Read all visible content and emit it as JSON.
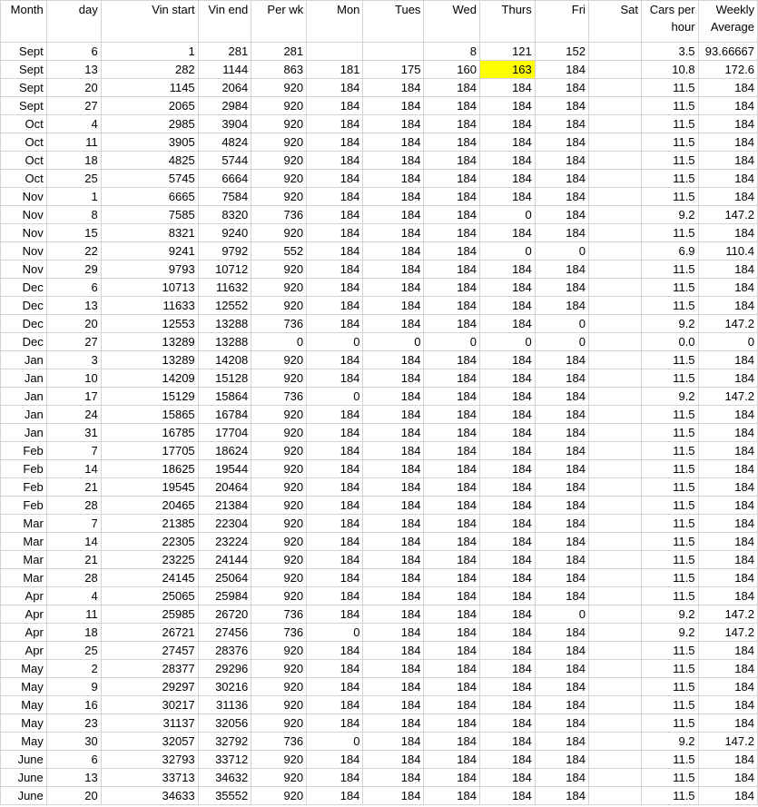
{
  "sheet": {
    "columns": [
      "Month",
      "day",
      "Vin start",
      "Vin end",
      "Per wk",
      "Mon",
      "Tues",
      "Wed",
      "Thurs",
      "Fri",
      "Sat",
      "Cars per hour",
      "Weekly Average"
    ],
    "highlight_color": "#ffff00",
    "highlighted_cells": [
      {
        "row": 1,
        "col": 8
      }
    ],
    "rows": [
      [
        "Sept",
        "6",
        "1",
        "281",
        "281",
        "",
        "",
        "8",
        "121",
        "152",
        "",
        "3.5",
        "93.66667"
      ],
      [
        "Sept",
        "13",
        "282",
        "1144",
        "863",
        "181",
        "175",
        "160",
        "163",
        "184",
        "",
        "10.8",
        "172.6"
      ],
      [
        "Sept",
        "20",
        "1145",
        "2064",
        "920",
        "184",
        "184",
        "184",
        "184",
        "184",
        "",
        "11.5",
        "184"
      ],
      [
        "Sept",
        "27",
        "2065",
        "2984",
        "920",
        "184",
        "184",
        "184",
        "184",
        "184",
        "",
        "11.5",
        "184"
      ],
      [
        "Oct",
        "4",
        "2985",
        "3904",
        "920",
        "184",
        "184",
        "184",
        "184",
        "184",
        "",
        "11.5",
        "184"
      ],
      [
        "Oct",
        "11",
        "3905",
        "4824",
        "920",
        "184",
        "184",
        "184",
        "184",
        "184",
        "",
        "11.5",
        "184"
      ],
      [
        "Oct",
        "18",
        "4825",
        "5744",
        "920",
        "184",
        "184",
        "184",
        "184",
        "184",
        "",
        "11.5",
        "184"
      ],
      [
        "Oct",
        "25",
        "5745",
        "6664",
        "920",
        "184",
        "184",
        "184",
        "184",
        "184",
        "",
        "11.5",
        "184"
      ],
      [
        "Nov",
        "1",
        "6665",
        "7584",
        "920",
        "184",
        "184",
        "184",
        "184",
        "184",
        "",
        "11.5",
        "184"
      ],
      [
        "Nov",
        "8",
        "7585",
        "8320",
        "736",
        "184",
        "184",
        "184",
        "0",
        "184",
        "",
        "9.2",
        "147.2"
      ],
      [
        "Nov",
        "15",
        "8321",
        "9240",
        "920",
        "184",
        "184",
        "184",
        "184",
        "184",
        "",
        "11.5",
        "184"
      ],
      [
        "Nov",
        "22",
        "9241",
        "9792",
        "552",
        "184",
        "184",
        "184",
        "0",
        "0",
        "",
        "6.9",
        "110.4"
      ],
      [
        "Nov",
        "29",
        "9793",
        "10712",
        "920",
        "184",
        "184",
        "184",
        "184",
        "184",
        "",
        "11.5",
        "184"
      ],
      [
        "Dec",
        "6",
        "10713",
        "11632",
        "920",
        "184",
        "184",
        "184",
        "184",
        "184",
        "",
        "11.5",
        "184"
      ],
      [
        "Dec",
        "13",
        "11633",
        "12552",
        "920",
        "184",
        "184",
        "184",
        "184",
        "184",
        "",
        "11.5",
        "184"
      ],
      [
        "Dec",
        "20",
        "12553",
        "13288",
        "736",
        "184",
        "184",
        "184",
        "184",
        "0",
        "",
        "9.2",
        "147.2"
      ],
      [
        "Dec",
        "27",
        "13289",
        "13288",
        "0",
        "0",
        "0",
        "0",
        "0",
        "0",
        "",
        "0.0",
        "0"
      ],
      [
        "Jan",
        "3",
        "13289",
        "14208",
        "920",
        "184",
        "184",
        "184",
        "184",
        "184",
        "",
        "11.5",
        "184"
      ],
      [
        "Jan",
        "10",
        "14209",
        "15128",
        "920",
        "184",
        "184",
        "184",
        "184",
        "184",
        "",
        "11.5",
        "184"
      ],
      [
        "Jan",
        "17",
        "15129",
        "15864",
        "736",
        "0",
        "184",
        "184",
        "184",
        "184",
        "",
        "9.2",
        "147.2"
      ],
      [
        "Jan",
        "24",
        "15865",
        "16784",
        "920",
        "184",
        "184",
        "184",
        "184",
        "184",
        "",
        "11.5",
        "184"
      ],
      [
        "Jan",
        "31",
        "16785",
        "17704",
        "920",
        "184",
        "184",
        "184",
        "184",
        "184",
        "",
        "11.5",
        "184"
      ],
      [
        "Feb",
        "7",
        "17705",
        "18624",
        "920",
        "184",
        "184",
        "184",
        "184",
        "184",
        "",
        "11.5",
        "184"
      ],
      [
        "Feb",
        "14",
        "18625",
        "19544",
        "920",
        "184",
        "184",
        "184",
        "184",
        "184",
        "",
        "11.5",
        "184"
      ],
      [
        "Feb",
        "21",
        "19545",
        "20464",
        "920",
        "184",
        "184",
        "184",
        "184",
        "184",
        "",
        "11.5",
        "184"
      ],
      [
        "Feb",
        "28",
        "20465",
        "21384",
        "920",
        "184",
        "184",
        "184",
        "184",
        "184",
        "",
        "11.5",
        "184"
      ],
      [
        "Mar",
        "7",
        "21385",
        "22304",
        "920",
        "184",
        "184",
        "184",
        "184",
        "184",
        "",
        "11.5",
        "184"
      ],
      [
        "Mar",
        "14",
        "22305",
        "23224",
        "920",
        "184",
        "184",
        "184",
        "184",
        "184",
        "",
        "11.5",
        "184"
      ],
      [
        "Mar",
        "21",
        "23225",
        "24144",
        "920",
        "184",
        "184",
        "184",
        "184",
        "184",
        "",
        "11.5",
        "184"
      ],
      [
        "Mar",
        "28",
        "24145",
        "25064",
        "920",
        "184",
        "184",
        "184",
        "184",
        "184",
        "",
        "11.5",
        "184"
      ],
      [
        "Apr",
        "4",
        "25065",
        "25984",
        "920",
        "184",
        "184",
        "184",
        "184",
        "184",
        "",
        "11.5",
        "184"
      ],
      [
        "Apr",
        "11",
        "25985",
        "26720",
        "736",
        "184",
        "184",
        "184",
        "184",
        "0",
        "",
        "9.2",
        "147.2"
      ],
      [
        "Apr",
        "18",
        "26721",
        "27456",
        "736",
        "0",
        "184",
        "184",
        "184",
        "184",
        "",
        "9.2",
        "147.2"
      ],
      [
        "Apr",
        "25",
        "27457",
        "28376",
        "920",
        "184",
        "184",
        "184",
        "184",
        "184",
        "",
        "11.5",
        "184"
      ],
      [
        "May",
        "2",
        "28377",
        "29296",
        "920",
        "184",
        "184",
        "184",
        "184",
        "184",
        "",
        "11.5",
        "184"
      ],
      [
        "May",
        "9",
        "29297",
        "30216",
        "920",
        "184",
        "184",
        "184",
        "184",
        "184",
        "",
        "11.5",
        "184"
      ],
      [
        "May",
        "16",
        "30217",
        "31136",
        "920",
        "184",
        "184",
        "184",
        "184",
        "184",
        "",
        "11.5",
        "184"
      ],
      [
        "May",
        "23",
        "31137",
        "32056",
        "920",
        "184",
        "184",
        "184",
        "184",
        "184",
        "",
        "11.5",
        "184"
      ],
      [
        "May",
        "30",
        "32057",
        "32792",
        "736",
        "0",
        "184",
        "184",
        "184",
        "184",
        "",
        "9.2",
        "147.2"
      ],
      [
        "June",
        "6",
        "32793",
        "33712",
        "920",
        "184",
        "184",
        "184",
        "184",
        "184",
        "",
        "11.5",
        "184"
      ],
      [
        "June",
        "13",
        "33713",
        "34632",
        "920",
        "184",
        "184",
        "184",
        "184",
        "184",
        "",
        "11.5",
        "184"
      ],
      [
        "June",
        "20",
        "34633",
        "35552",
        "920",
        "184",
        "184",
        "184",
        "184",
        "184",
        "",
        "11.5",
        "184"
      ]
    ]
  }
}
